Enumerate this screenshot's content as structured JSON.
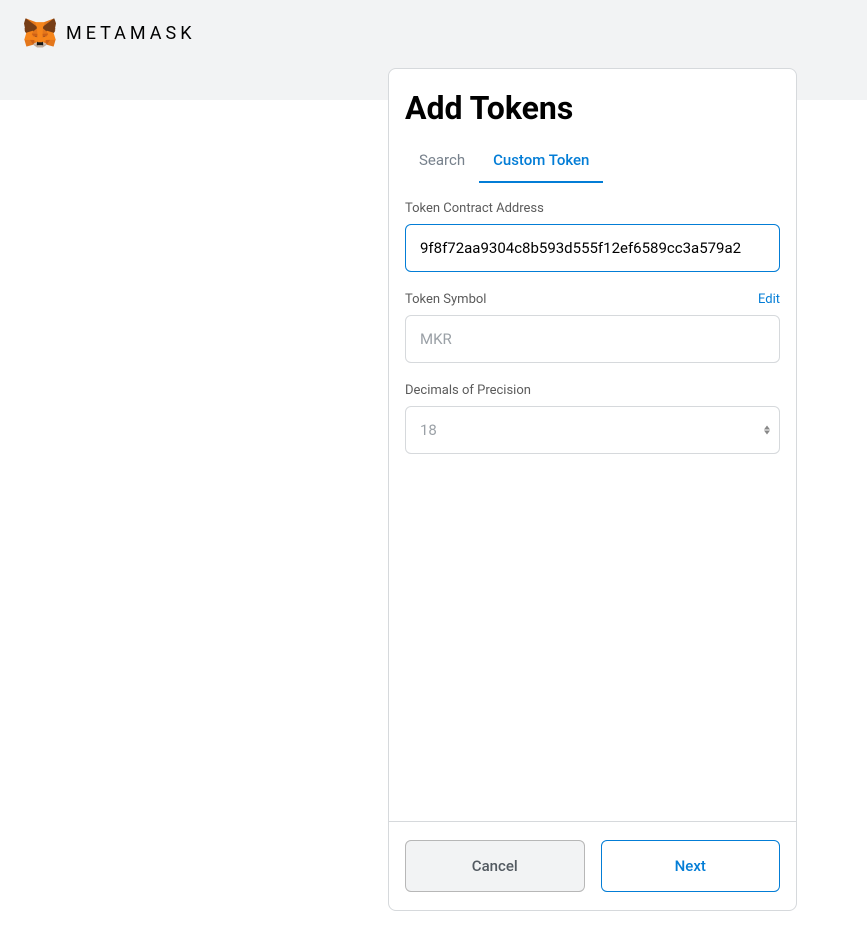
{
  "brand": "METAMASK",
  "modal": {
    "title": "Add Tokens",
    "tabs": {
      "search": "Search",
      "custom": "Custom Token"
    },
    "fields": {
      "contract": {
        "label": "Token Contract Address",
        "value": "9f8f72aa9304c8b593d555f12ef6589cc3a579a2"
      },
      "symbol": {
        "label": "Token Symbol",
        "edit": "Edit",
        "value": "MKR"
      },
      "decimals": {
        "label": "Decimals of Precision",
        "value": "18"
      }
    },
    "buttons": {
      "cancel": "Cancel",
      "next": "Next"
    }
  }
}
